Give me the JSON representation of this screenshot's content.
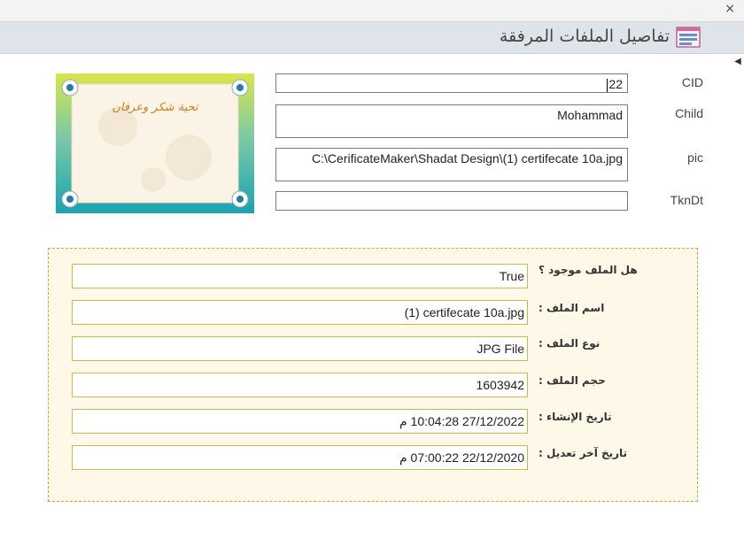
{
  "window": {
    "close_glyph": "×"
  },
  "header": {
    "title": "تفاصيل الملفات المرفقة",
    "icon": "form-icon"
  },
  "picture": {
    "caption": "تحية شكر وعرفان",
    "colors": {
      "frame_top": "#d8e64a",
      "frame_bottom": "#1aa3b0",
      "card": "#fbf4e6"
    }
  },
  "fields": {
    "cid": {
      "label": "CID",
      "value": "22"
    },
    "child": {
      "label": "Child",
      "value": "Mohammad"
    },
    "pic": {
      "label": "pic",
      "value": "C:\\CerificateMaker\\Shadat Design\\(1) certifecate 10a.jpg"
    },
    "tkndt": {
      "label": "TknDt",
      "value": ""
    }
  },
  "file_info": {
    "exists": {
      "label": "هل الملف موجود ؟",
      "value": "True"
    },
    "name": {
      "label": "اسم الملف :",
      "value": "(1) certifecate 10a.jpg"
    },
    "type": {
      "label": "نوع الملف :",
      "value": "JPG File"
    },
    "size": {
      "label": "حجم الملف :",
      "value": "1603942"
    },
    "created": {
      "label": "تاريخ الإنشاء :",
      "value": "27/12/2022 10:04:28 م"
    },
    "modified": {
      "label": "تاريخ آخر تعديل :",
      "value": "22/12/2020 07:00:22 م"
    }
  }
}
